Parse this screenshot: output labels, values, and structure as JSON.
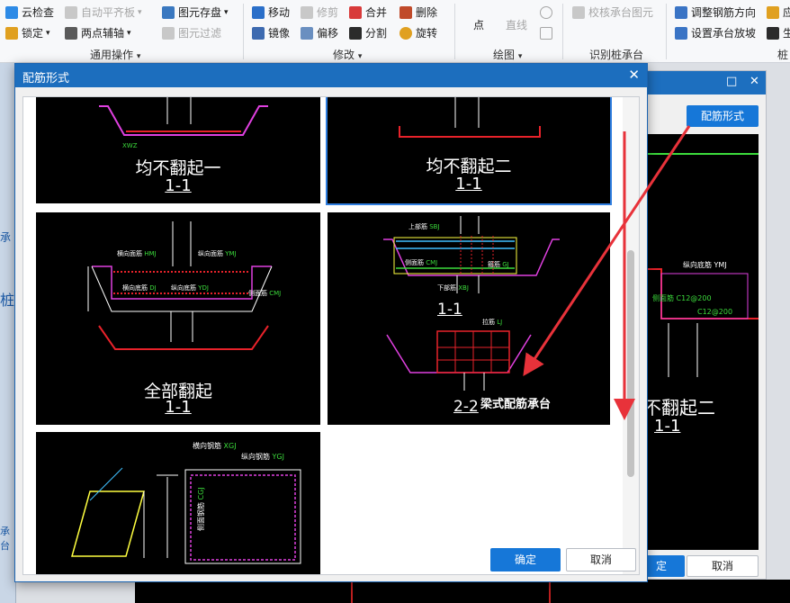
{
  "ribbon": {
    "groups": [
      {
        "label": "通用操作",
        "items": [
          {
            "label": "云检查",
            "enabled": true
          },
          {
            "label": "自动平齐板",
            "enabled": false
          },
          {
            "label": "锁定",
            "enabled": true
          },
          {
            "label": "两点辅轴",
            "enabled": true
          },
          {
            "label": "图元存盘",
            "enabled": true
          },
          {
            "label": "图元过滤",
            "enabled": false
          }
        ]
      },
      {
        "label": "修改",
        "items": [
          {
            "label": "移动",
            "enabled": true
          },
          {
            "label": "修剪",
            "enabled": false
          },
          {
            "label": "合并",
            "enabled": true
          },
          {
            "label": "删除",
            "enabled": true
          },
          {
            "label": "镜像",
            "enabled": true
          },
          {
            "label": "偏移",
            "enabled": true
          },
          {
            "label": "分割",
            "enabled": true
          },
          {
            "label": "旋转",
            "enabled": true
          }
        ]
      },
      {
        "label": "绘图",
        "items": [
          {
            "label": "点",
            "enabled": true
          },
          {
            "label": "直线",
            "enabled": false
          }
        ]
      },
      {
        "label": "识别桩承台",
        "items": [
          {
            "label": "校核承台图元",
            "enabled": false
          }
        ]
      },
      {
        "label": "桩",
        "items": [
          {
            "label": "调整钢筋方向",
            "enabled": true
          },
          {
            "label": "设置承台放坡",
            "enabled": true
          },
          {
            "label": "应",
            "enabled": true
          },
          {
            "label": "生",
            "enabled": true
          }
        ]
      }
    ]
  },
  "background_panel": {
    "rebar_form_button": "配筋形式",
    "preview_caption_title": "不翻起二",
    "preview_caption_section": "1-1",
    "ok_partial": "定",
    "cancel": "取消",
    "left_strip_labels": [
      "承",
      "桩",
      "承台"
    ]
  },
  "dialog": {
    "title": "配筋形式",
    "ok": "确定",
    "cancel": "取消",
    "options": [
      {
        "title": "均不翻起一",
        "section": "1-1",
        "selected": false
      },
      {
        "title": "均不翻起二",
        "section": "1-1",
        "selected": true
      },
      {
        "title": "全部翻起",
        "section": "1-1",
        "selected": false,
        "labels": {
          "horiz_top": "横向面筋",
          "horiz_top_code": "HMJ",
          "long_top": "纵向面筋",
          "long_top_code": "YMJ",
          "side": "侧面筋",
          "side_code": "CMJ",
          "horiz_bottom": "横向底筋",
          "horiz_bottom_code": "DJ",
          "long_bottom": "纵向底筋",
          "long_bottom_code": "YDJ"
        }
      },
      {
        "title": "梁式配筋承台",
        "section_a": "1-1",
        "section_b": "2-2",
        "selected": false,
        "labels": {
          "top": "上部筋",
          "top_code": "SBJ",
          "stirrup": "箍筋",
          "stirrup_code": "GJ",
          "bottom": "下部筋",
          "bottom_code": "XBJ",
          "side": "侧面筋",
          "side_code": "CMJ",
          "hook": "拉筋",
          "hook_code": "LJ"
        }
      },
      {
        "title": "",
        "selected": false,
        "labels": {
          "horiz": "横向钢筋",
          "horiz_code": "XGJ",
          "long": "纵向钢筋",
          "long_code": "YGJ",
          "side": "侧面钢筋",
          "side_code": "CGJ"
        }
      }
    ]
  },
  "colors": {
    "accent": "#1677d8",
    "title_bar": "#1c6ebe",
    "cad_red": "#e8222a",
    "cad_magenta": "#e040e0",
    "cad_green": "#3cdc3c",
    "annotation_arrow": "#e8323a"
  }
}
